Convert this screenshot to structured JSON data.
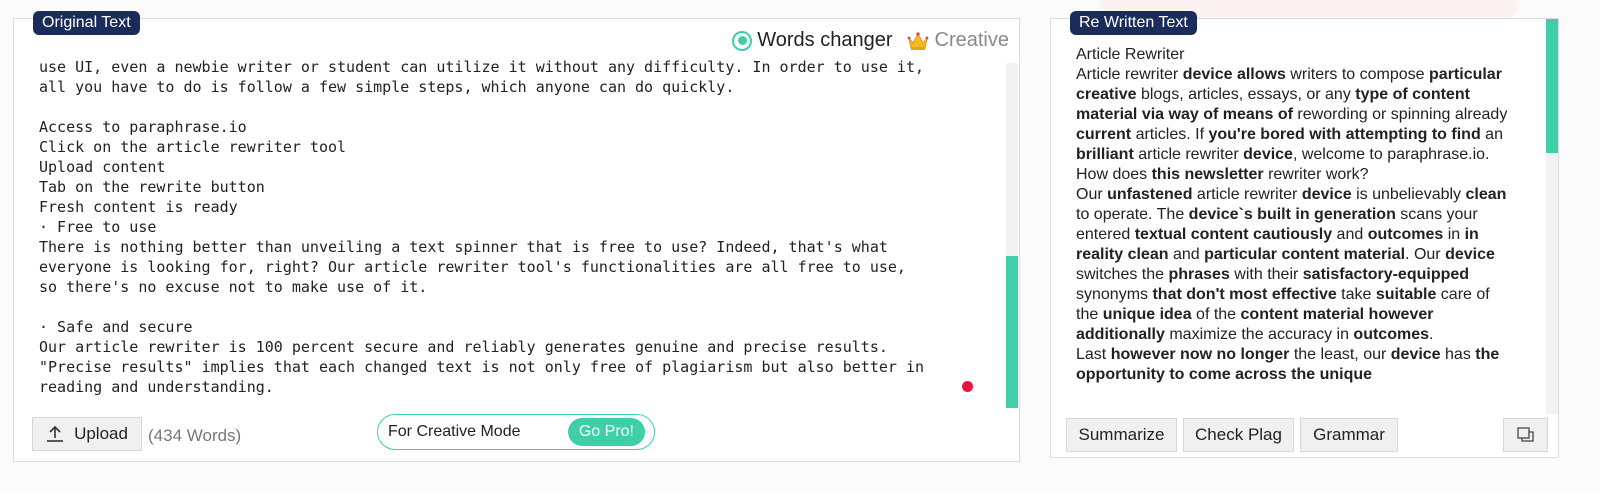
{
  "left": {
    "tag": "Original Text",
    "mode_active": "Words changer",
    "mode_locked": "Creative",
    "text_lines": [
      "use UI, even a newbie writer or student can utilize it without any difficulty. In order to use it,",
      "all you have to do is follow a few simple steps, which anyone can do quickly.",
      "",
      "Access to paraphrase.io",
      "Click on the article rewriter tool",
      "Upload content",
      "Tab on the rewrite button",
      "Fresh content is ready",
      "· Free to use",
      "There is nothing better than unveiling a text spinner that is free to use? Indeed, that's what",
      "everyone is looking for, right? Our article rewriter tool's functionalities are all free to use,",
      "so there's no excuse not to make use of it.",
      "",
      "· Safe and secure",
      "Our article rewriter is 100 percent secure and reliably generates genuine and precise results.",
      "\"Precise results\" implies that each changed text is not only free of plagiarism but also better in",
      "reading and understanding."
    ],
    "upload_label": "Upload",
    "word_count": "(434 Words)",
    "promo_text": "For Creative Mode",
    "promo_button": "Go Pro!"
  },
  "right": {
    "tag": "Re Written Text",
    "paragraphs": [
      [
        {
          "t": "Article Rewriter"
        }
      ],
      [
        {
          "t": "Article rewriter "
        },
        {
          "t": "device allows",
          "b": true
        },
        {
          "t": " writers to compose "
        },
        {
          "t": "particular creative",
          "b": true
        },
        {
          "t": " blogs, articles, essays, or any "
        },
        {
          "t": "type of content material via way of means of",
          "b": true
        },
        {
          "t": " rewording or spinning already "
        },
        {
          "t": "current",
          "b": true
        },
        {
          "t": " articles. If "
        },
        {
          "t": "you're bored with attempting to find",
          "b": true
        },
        {
          "t": " an "
        },
        {
          "t": "brilliant",
          "b": true
        },
        {
          "t": " article rewriter "
        },
        {
          "t": "device",
          "b": true
        },
        {
          "t": ", welcome to paraphrase.io."
        }
      ],
      [
        {
          "t": " How does "
        },
        {
          "t": "this newsletter",
          "b": true
        },
        {
          "t": " rewriter work?"
        }
      ],
      [
        {
          "t": "Our "
        },
        {
          "t": "unfastened",
          "b": true
        },
        {
          "t": " article rewriter "
        },
        {
          "t": "device",
          "b": true
        },
        {
          "t": " is unbelievably "
        },
        {
          "t": "clean",
          "b": true
        },
        {
          "t": " to operate. The "
        },
        {
          "t": "device`s",
          "b": true
        },
        {
          "t": " "
        },
        {
          "t": "built in generation",
          "b": true
        },
        {
          "t": " scans your entered "
        },
        {
          "t": "textual content cautiously",
          "b": true
        },
        {
          "t": " and "
        },
        {
          "t": "outcomes",
          "b": true
        },
        {
          "t": " in "
        },
        {
          "t": "in reality clean",
          "b": true
        },
        {
          "t": " and "
        },
        {
          "t": "particular content material",
          "b": true
        },
        {
          "t": ". Our "
        },
        {
          "t": "device",
          "b": true
        },
        {
          "t": " switches the "
        },
        {
          "t": "phrases",
          "b": true
        },
        {
          "t": " with their "
        },
        {
          "t": "satisfactory-equipped",
          "b": true
        },
        {
          "t": " synonyms "
        },
        {
          "t": "that don't most effective",
          "b": true
        },
        {
          "t": " take "
        },
        {
          "t": "suitable",
          "b": true
        },
        {
          "t": " care of the "
        },
        {
          "t": "unique idea",
          "b": true
        },
        {
          "t": " of the "
        },
        {
          "t": "content material however additionally",
          "b": true
        },
        {
          "t": " maximize the accuracy in "
        },
        {
          "t": "outcomes",
          "b": true
        },
        {
          "t": "."
        }
      ],
      [
        {
          "t": " Last "
        },
        {
          "t": "however now no longer",
          "b": true
        },
        {
          "t": " the least, our "
        },
        {
          "t": "device",
          "b": true
        },
        {
          "t": " has "
        },
        {
          "t": "the opportunity to come across the unique",
          "b": true
        }
      ]
    ],
    "buttons": {
      "summarize": "Summarize",
      "check_plag": "Check Plag",
      "grammar": "Grammar"
    }
  },
  "icons": {
    "radio": "radio-selected-icon",
    "crown": "crown-icon",
    "upload": "upload-icon",
    "copy": "copy-icon"
  },
  "colors": {
    "accent": "#3ecfa9",
    "tag_bg": "#1a2d5a",
    "dot": "#e8163b"
  }
}
